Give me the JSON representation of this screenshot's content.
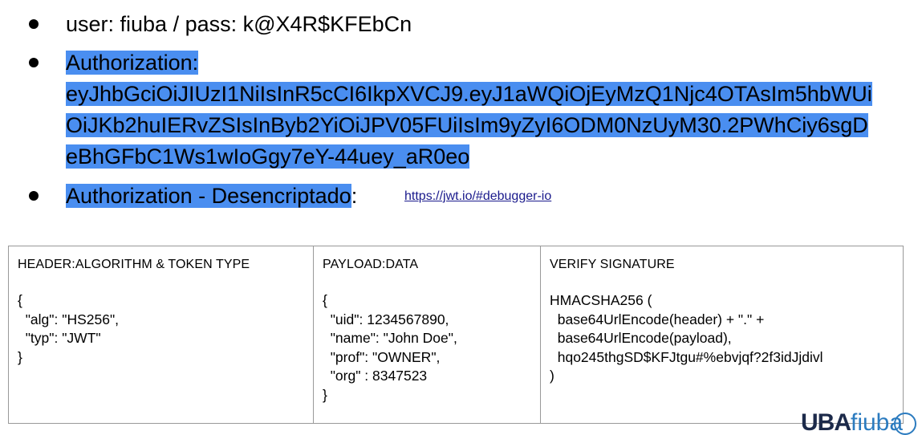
{
  "bullets": {
    "credentials": "user: fiuba / pass: k@X4R$KFEbCn",
    "authorization_label": "Authorization:",
    "token_lines": [
      "eyJhbGciOiJIUzI1NiIsInR5cCI6IkpXVCJ9.eyJ1aWQiOjEyMzQ1Njc4OTAsIm5hbWUi",
      "OiJKb2huIERvZSIsInByb2YiOiJPV05FUiIsIm9yZyI6ODM0NzUyM30.2PWhCiy6sgD",
      "eBhGFbC1Ws1wIoGgy7eY-44uey_aR0eo"
    ],
    "decoded_label": "Authorization - Desencriptado",
    "decoded_colon": ":",
    "link_text": "https://jwt.io/#debugger-io"
  },
  "table": {
    "header": {
      "title": "HEADER:ALGORITHM & TOKEN TYPE",
      "lines": [
        "{",
        "  \"alg\": \"HS256\",",
        "  \"typ\": \"JWT\"",
        "}"
      ]
    },
    "payload": {
      "title": "PAYLOAD:DATA",
      "lines": [
        "{",
        "  \"uid\": 1234567890,",
        "  \"name\": \"John Doe\",",
        "  \"prof\": \"OWNER\",",
        "  \"org\" : 8347523",
        "}"
      ]
    },
    "signature": {
      "title": "VERIFY SIGNATURE",
      "lines": [
        "HMACSHA256 (",
        "  base64UrlEncode(header) + \".\" +",
        "  base64UrlEncode(payload),",
        "  hqo245thgSD$KFJtgu#%ebvjqf?2f3idJjdivl",
        ")"
      ]
    }
  },
  "logo": {
    "part1": "UBA",
    "part2": "fiuba"
  }
}
